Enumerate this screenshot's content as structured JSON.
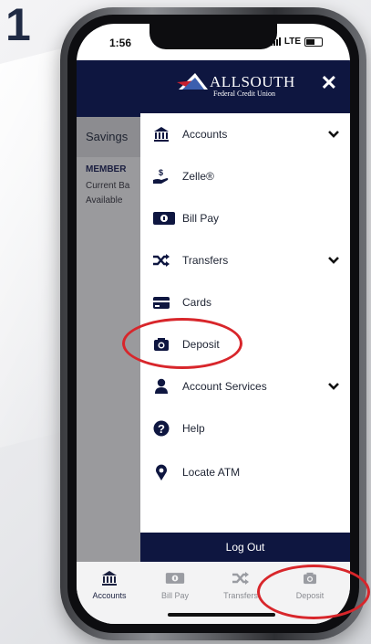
{
  "step_number": "1",
  "status": {
    "time": "1:56",
    "network": "LTE"
  },
  "background_app": {
    "savings_label": "Savings",
    "member_label": "MEMBER",
    "current_balance_label": "Current Ba",
    "available_balance_label": "Available"
  },
  "menu": {
    "logo_name": "ALLSOUTH",
    "logo_sub": "Federal Credit Union",
    "close_symbol": "✕",
    "items": [
      {
        "label": "Accounts",
        "icon": "bank-icon",
        "has_submenu": true
      },
      {
        "label": "Zelle®",
        "icon": "zelle-hand-icon",
        "has_submenu": false
      },
      {
        "label": "Bill Pay",
        "icon": "bill-icon",
        "has_submenu": false
      },
      {
        "label": "Transfers",
        "icon": "shuffle-icon",
        "has_submenu": true
      },
      {
        "label": "Cards",
        "icon": "card-icon",
        "has_submenu": false
      },
      {
        "label": "Deposit",
        "icon": "camera-icon",
        "has_submenu": false
      },
      {
        "label": "Account Services",
        "icon": "user-icon",
        "has_submenu": true
      },
      {
        "label": "Help",
        "icon": "help-icon",
        "has_submenu": false
      },
      {
        "label": "Locate ATM",
        "icon": "location-pin-icon",
        "has_submenu": false
      }
    ],
    "logout_label": "Log Out"
  },
  "tabbar": [
    {
      "label": "Accounts",
      "icon": "bank-icon",
      "active": true
    },
    {
      "label": "Bill Pay",
      "icon": "bill-icon",
      "active": false
    },
    {
      "label": "Transfers",
      "icon": "shuffle-icon",
      "active": false
    },
    {
      "label": "Deposit",
      "icon": "camera-icon",
      "active": false
    }
  ],
  "colors": {
    "navy": "#0e1640",
    "highlight_ring": "#d8262b",
    "logo_red": "#c8202f"
  }
}
